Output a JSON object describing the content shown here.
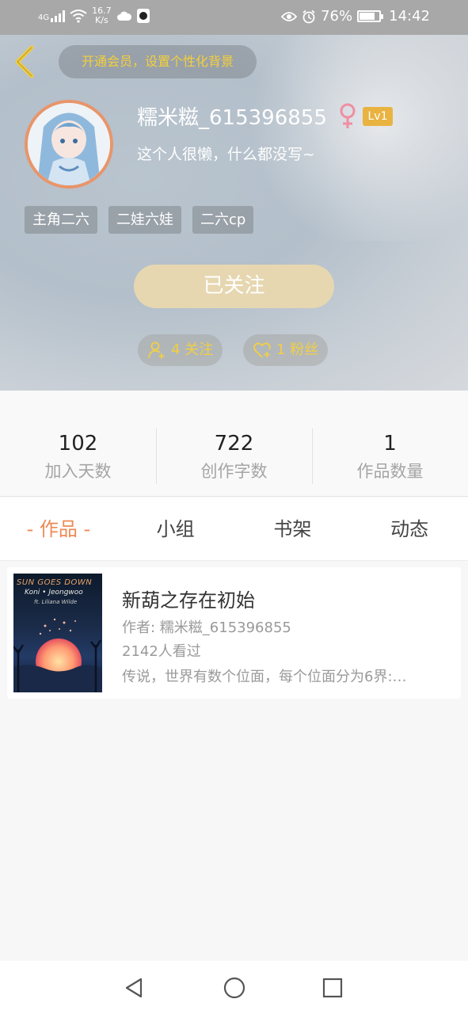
{
  "status_bar": {
    "signal": "4G",
    "net_speed_value": "16.7",
    "net_speed_unit": "K/s",
    "battery": "76%",
    "time": "14:42"
  },
  "header": {
    "vip_prompt": "开通会员，设置个性化背景",
    "username": "糯米糍_615396855",
    "level": "Lv1",
    "bio": "这个人很懒，什么都没写~",
    "tags": [
      "主角二六",
      "二娃六娃",
      "二六cp"
    ],
    "follow_button": "已关注",
    "following_label": "4 关注",
    "fans_label": "1 粉丝",
    "accent_color": "#f1cf44"
  },
  "stats": [
    {
      "value": "102",
      "label": "加入天数"
    },
    {
      "value": "722",
      "label": "创作字数"
    },
    {
      "value": "1",
      "label": "作品数量"
    }
  ],
  "tabs": [
    {
      "label": "- 作品 -",
      "active": true
    },
    {
      "label": "小组",
      "active": false
    },
    {
      "label": "书架",
      "active": false
    },
    {
      "label": "动态",
      "active": false
    }
  ],
  "works": [
    {
      "title": "新葫之存在初始",
      "author": "作者: 糯米糍_615396855",
      "views": "2142人看过",
      "description": "传说，世界有数个位面，每个位面分为6界:…",
      "cover_title": "SUN GOES DOWN",
      "cover_subtitle": "Koni • Jeongwoo",
      "cover_credit": "ft. Liliana Wilde"
    }
  ],
  "navbar": {
    "back": "back-triangle-icon",
    "home": "home-circle-icon",
    "recents": "recents-square-icon"
  }
}
